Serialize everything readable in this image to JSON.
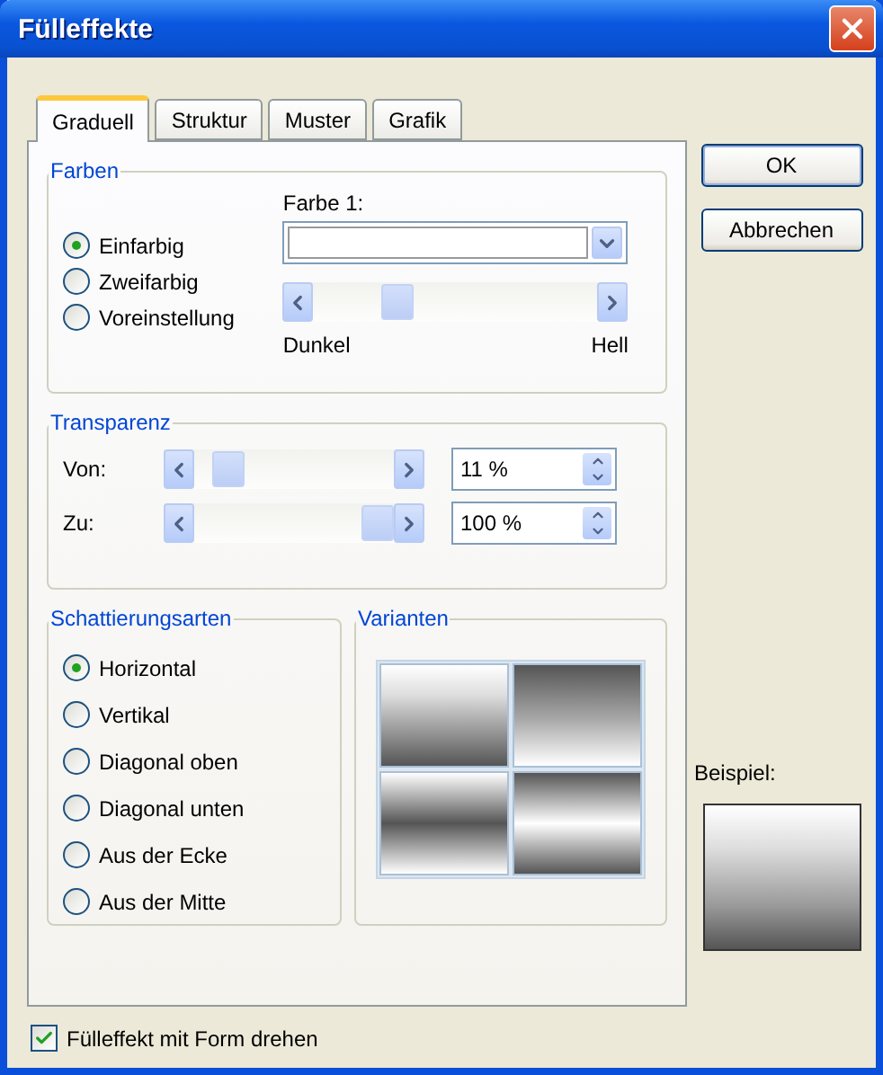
{
  "window": {
    "title": "Fülleffekte"
  },
  "tabs": [
    {
      "label": "Graduell",
      "selected": true
    },
    {
      "label": "Struktur",
      "selected": false
    },
    {
      "label": "Muster",
      "selected": false
    },
    {
      "label": "Grafik",
      "selected": false
    }
  ],
  "farben": {
    "title": "Farben",
    "options": [
      {
        "label": "Einfarbig",
        "selected": true
      },
      {
        "label": "Zweifarbig",
        "selected": false
      },
      {
        "label": "Voreinstellung",
        "selected": false
      }
    ],
    "color_label": "Farbe 1:",
    "slider": {
      "min_label": "Dunkel",
      "max_label": "Hell"
    }
  },
  "transparenz": {
    "title": "Transparenz",
    "rows": [
      {
        "label": "Von:",
        "value": "11 %"
      },
      {
        "label": "Zu:",
        "value": "100 %"
      }
    ]
  },
  "schattierungsarten": {
    "title": "Schattierungsarten",
    "options": [
      {
        "label": "Horizontal",
        "selected": true
      },
      {
        "label": "Vertikal",
        "selected": false
      },
      {
        "label": "Diagonal oben",
        "selected": false
      },
      {
        "label": "Diagonal unten",
        "selected": false
      },
      {
        "label": "Aus der Ecke",
        "selected": false
      },
      {
        "label": "Aus der Mitte",
        "selected": false
      }
    ]
  },
  "varianten": {
    "title": "Varianten",
    "tiles": [
      {
        "kind": "light-dark"
      },
      {
        "kind": "dark-light"
      },
      {
        "kind": "light-dark-light"
      },
      {
        "kind": "dark-light-dark"
      }
    ]
  },
  "buttons": [
    "OK",
    "Abbrechen"
  ],
  "beispiel": {
    "label": "Beispiel:"
  },
  "rotate_checkbox": {
    "label": "Fülleffekt mit Form drehen",
    "checked": true
  }
}
